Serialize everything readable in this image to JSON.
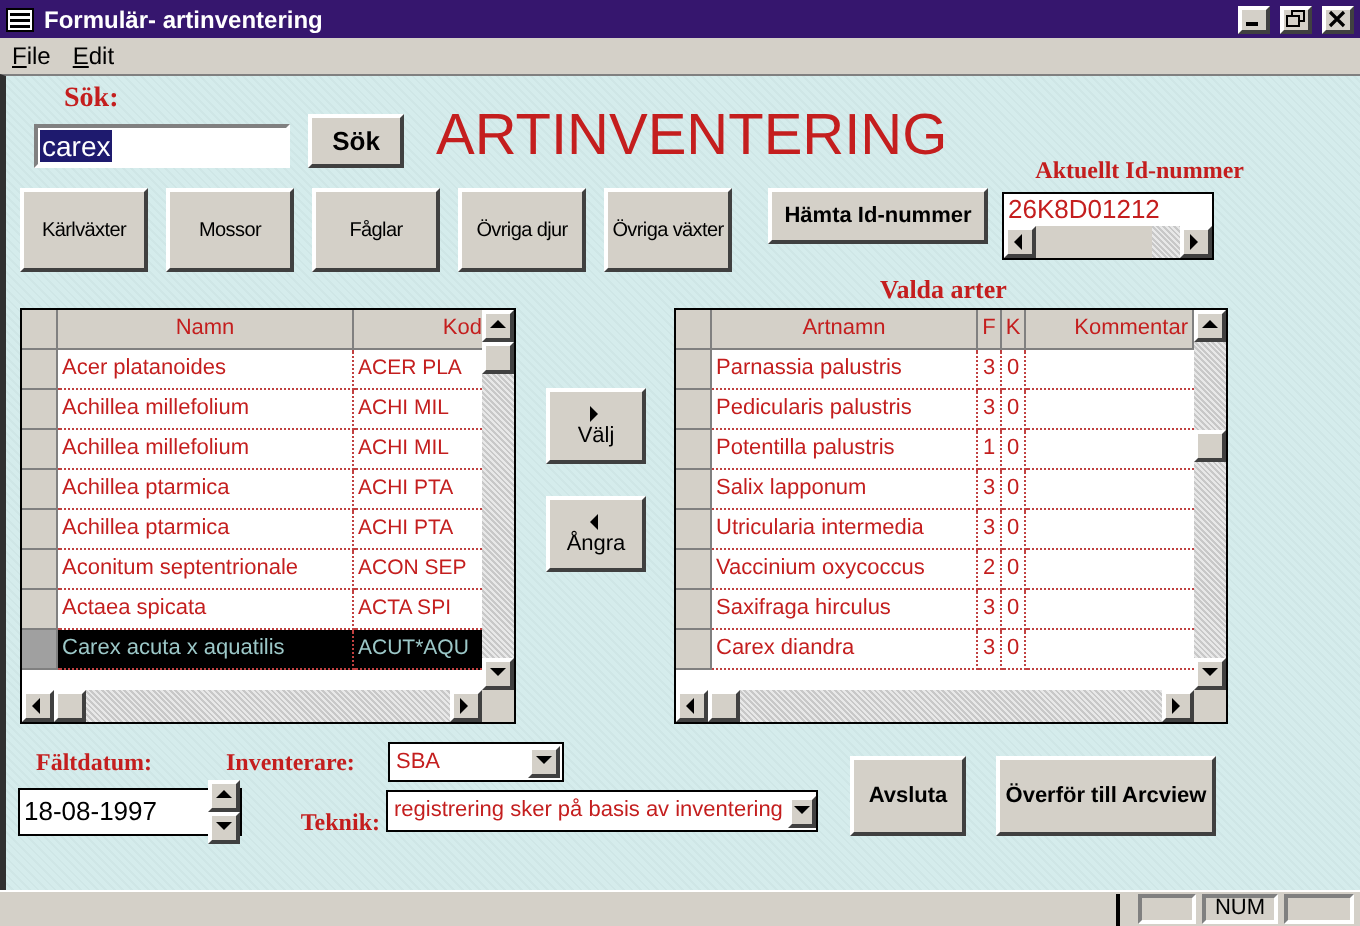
{
  "window": {
    "title": "Formulär- artinventering"
  },
  "menu": [
    {
      "label": "File"
    },
    {
      "label": "Edit"
    }
  ],
  "search": {
    "label": "Sök:",
    "value": "carex",
    "button": "Sök"
  },
  "heading": "ARTINVENTERING",
  "category_buttons": [
    "Kärlväxter",
    "Mossor",
    "Fåglar",
    "Övriga djur",
    "Övriga växter"
  ],
  "id_number": {
    "label": "Aktuellt Id-nummer",
    "button": "Hämta Id-nummer",
    "value": "26K8D01212"
  },
  "species_list": {
    "columns": [
      "Namn",
      "Kod"
    ],
    "rows": [
      {
        "name": "Acer platanoides",
        "code": "ACER PLA",
        "selected": false
      },
      {
        "name": "Achillea millefolium",
        "code": "ACHI MIL",
        "selected": false
      },
      {
        "name": "Achillea millefolium",
        "code": "ACHI MIL",
        "selected": false
      },
      {
        "name": "Achillea ptarmica",
        "code": "ACHI PTA",
        "selected": false
      },
      {
        "name": "Achillea ptarmica",
        "code": "ACHI PTA",
        "selected": false
      },
      {
        "name": "Aconitum septentrionale",
        "code": "ACON SEP",
        "selected": false
      },
      {
        "name": "Actaea spicata",
        "code": "ACTA SPI",
        "selected": false
      },
      {
        "name": "Carex acuta x aquatilis",
        "code": "ACUT*AQU",
        "selected": true
      }
    ]
  },
  "move_buttons": [
    {
      "label": "Välj",
      "kind": "right"
    },
    {
      "label": "Ångra",
      "kind": "left"
    }
  ],
  "selected_species": {
    "title": "Valda arter",
    "columns": [
      "Artnamn",
      "F",
      "K",
      "Kommentar"
    ],
    "rows": [
      {
        "name": "Parnassia palustris",
        "f": "3",
        "k": "0"
      },
      {
        "name": "Pedicularis palustris",
        "f": "3",
        "k": "0"
      },
      {
        "name": "Potentilla palustris",
        "f": "1",
        "k": "0"
      },
      {
        "name": "Salix lapponum",
        "f": "3",
        "k": "0"
      },
      {
        "name": "Utricularia intermedia",
        "f": "3",
        "k": "0"
      },
      {
        "name": "Vaccinium oxycoccus",
        "f": "2",
        "k": "0"
      },
      {
        "name": "Saxifraga hirculus",
        "f": "3",
        "k": "0"
      },
      {
        "name": "Carex diandra",
        "f": "3",
        "k": "0"
      }
    ]
  },
  "field_date": {
    "label": "Fältdatum:",
    "value": "18-08-1997"
  },
  "inventerare": {
    "label": "Inventerare:",
    "value": "SBA"
  },
  "teknik": {
    "label": "Teknik:",
    "value": "registrering sker på basis av inventering"
  },
  "action_buttons": [
    "Avsluta",
    "Överför till Arcview"
  ],
  "status_bar": {
    "indicator": "NUM"
  }
}
